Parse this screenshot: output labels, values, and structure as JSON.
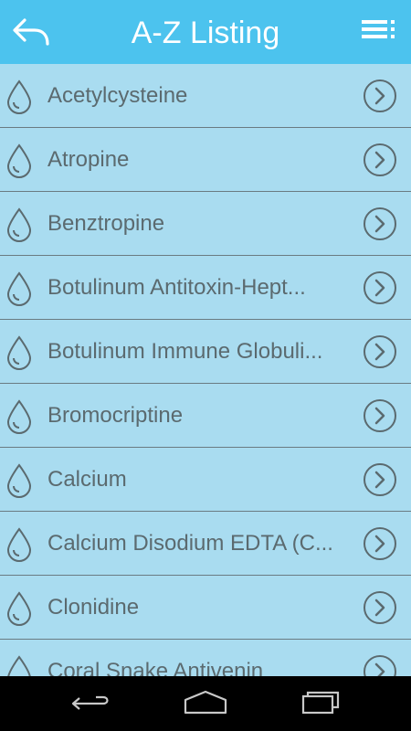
{
  "header": {
    "title": "A-Z Listing",
    "back_icon": "back-arrow-icon",
    "menu_icon": "menu-icon"
  },
  "items": [
    {
      "label": "Acetylcysteine"
    },
    {
      "label": "Atropine"
    },
    {
      "label": "Benztropine"
    },
    {
      "label": "Botulinum Antitoxin-Hept..."
    },
    {
      "label": "Botulinum Immune Globuli..."
    },
    {
      "label": "Bromocriptine"
    },
    {
      "label": "Calcium"
    },
    {
      "label": "Calcium Disodium EDTA (C..."
    },
    {
      "label": "Clonidine"
    },
    {
      "label": "Coral Snake Antivenin"
    }
  ],
  "colors": {
    "header": "#4cc3ee",
    "background": "#a9dcf0",
    "text": "#5b6a6f"
  }
}
